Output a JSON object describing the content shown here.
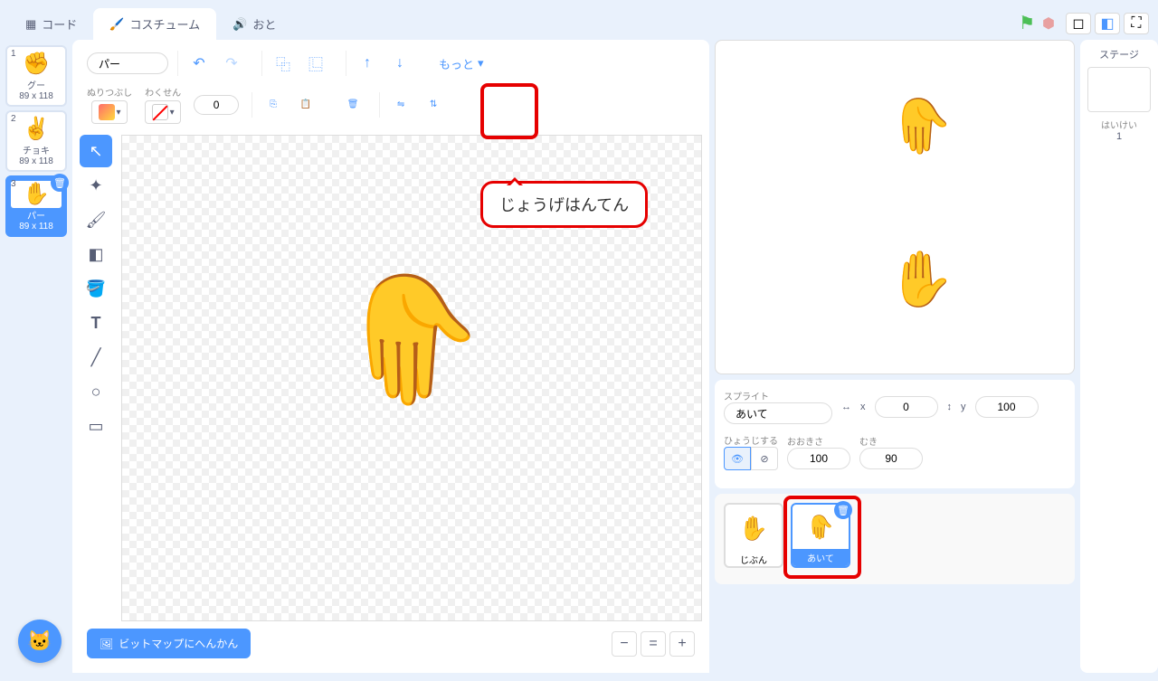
{
  "tabs": {
    "code": "コード",
    "costumes": "コスチューム",
    "sounds": "おと"
  },
  "costumes": [
    {
      "num": "1",
      "name": "グー",
      "size": "89 x 118",
      "emoji": "✊"
    },
    {
      "num": "2",
      "name": "チョキ",
      "size": "89 x 118",
      "emoji": "✌️"
    },
    {
      "num": "3",
      "name": "パー",
      "size": "89 x 118",
      "emoji": "✋"
    }
  ],
  "editor": {
    "name_value": "パー",
    "fill_label": "ぬりつぶし",
    "stroke_label": "わくせん",
    "stroke_width": "0",
    "more": "もっと",
    "bitmap_btn": "ビットマップにへんかん"
  },
  "callout": "じょうげはんてん",
  "sprite_panel": {
    "title": "スプライト",
    "name": "あいて",
    "x_label": "x",
    "x": "0",
    "y_label": "y",
    "y": "100",
    "show_label": "ひょうじする",
    "size_label": "おおきさ",
    "size": "100",
    "direction_label": "むき",
    "direction": "90"
  },
  "sprites": [
    {
      "name": "じぶん",
      "emoji": "✋"
    },
    {
      "name": "あいて",
      "emoji": "✋"
    }
  ],
  "stage_panel": {
    "title": "ステージ",
    "backdrop_label": "はいけい",
    "backdrop_count": "1"
  }
}
